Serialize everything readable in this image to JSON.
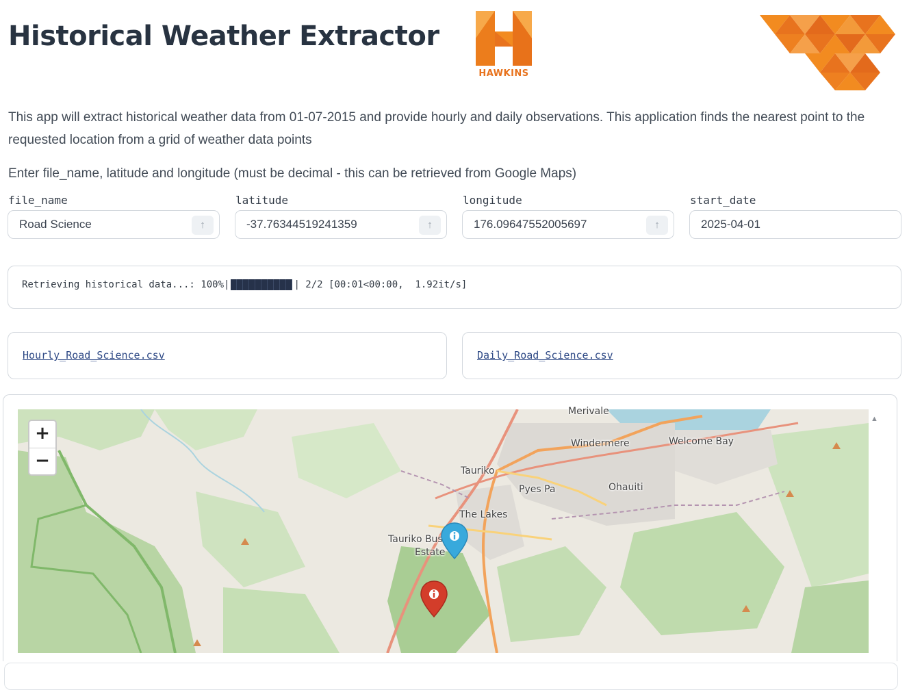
{
  "header": {
    "title": "Historical Weather Extractor",
    "logo_h_text": "HAWKINS"
  },
  "description": "This app will extract historical weather data from 01-07-2015 and provide hourly and daily observations. This application finds the nearest point to the requested location from a grid of weather data points",
  "instructions": "Enter file_name, latitude and longitude (must be decimal - this can be retrieved from Google Maps)",
  "inputs": {
    "file_name": {
      "label": "file_name",
      "value": "Road Science"
    },
    "latitude": {
      "label": "latitude",
      "value": "-37.76344519241359"
    },
    "longitude": {
      "label": "longitude",
      "value": "176.09647552005697"
    },
    "start_date": {
      "label": "start_date",
      "value": "2025-04-01"
    }
  },
  "progress": {
    "prefix": "Retrieving historical data...: 100%|",
    "suffix": "| 2/2 [00:01<00:00,  1.92it/s]",
    "percent": 100
  },
  "downloads": {
    "hourly": "Hourly_Road_Science.csv",
    "daily": "Daily_Road_Science.csv"
  },
  "map": {
    "zoom_in": "+",
    "zoom_out": "−",
    "places": {
      "merivale": "Merivale",
      "windermere": "Windermere",
      "welcome_bay": "Welcome Bay",
      "tauriko": "Tauriko",
      "pyes_pa": "Pyes Pa",
      "ohauiti": "Ohauiti",
      "the_lakes": "The Lakes",
      "tauriko_bus": "Tauriko Bus",
      "estate": "Estate"
    },
    "markers": [
      {
        "name": "blue-marker",
        "color": "#38a9dc"
      },
      {
        "name": "red-marker",
        "color": "#d33d2a"
      }
    ]
  },
  "colors": {
    "accent_orange": "#f28b20",
    "logo_orange": "#e8731e",
    "title": "#283341",
    "link": "#2f4a86"
  }
}
